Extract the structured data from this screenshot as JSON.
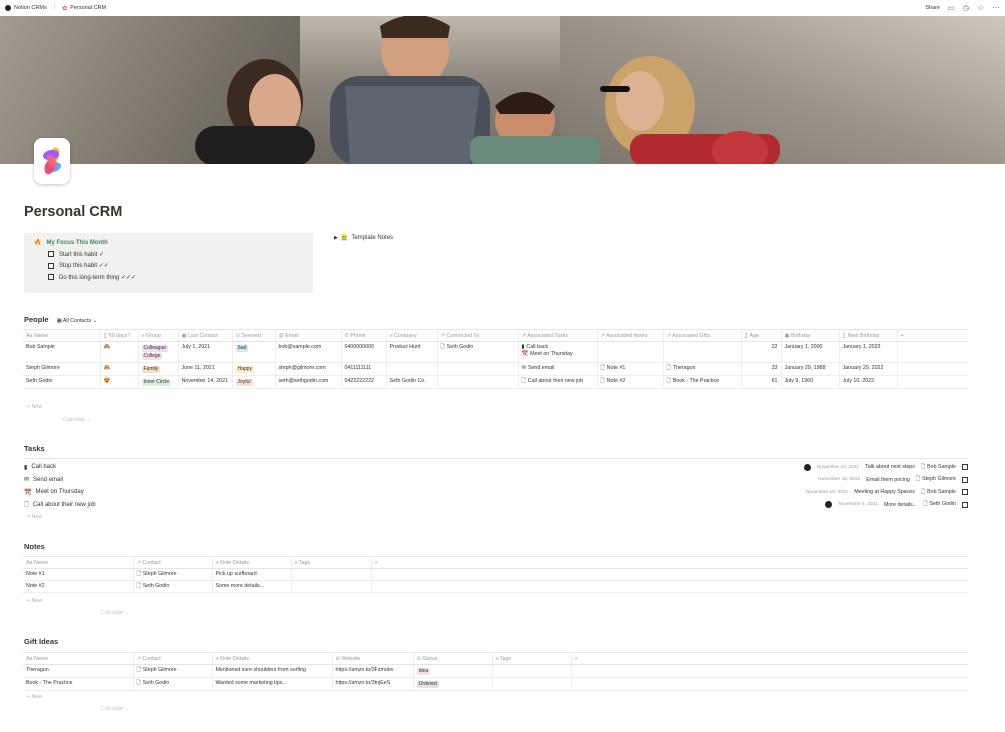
{
  "breadcrumb": {
    "parent": "Notion CRMs",
    "current": "Personal CRM"
  },
  "topbar": {
    "share": "Share"
  },
  "title": "Personal CRM",
  "focus": {
    "heading": "My Focus This Month",
    "items": [
      "Start this habit ✓",
      "Stop this habit ✓✓",
      "Do this long-term thing ✓✓✓"
    ]
  },
  "template_notes": "Template Notes",
  "people": {
    "title": "People",
    "view": "All Contacts",
    "columns": [
      "Name",
      "60 days?",
      "Group",
      "Last Contact",
      "Seemed",
      "Email",
      "Phone",
      "Company",
      "Connected To",
      "Associated Tasks",
      "Associated Notes",
      "Associated Gifts",
      "Age",
      "Birthday",
      "Next Birthday"
    ],
    "rows": [
      {
        "name": "Bob Sample",
        "d60": "🙈",
        "group": [
          "Colleague",
          "College"
        ],
        "last": "July 1, 2021",
        "seemed": "Sad",
        "email": "bob@sample.com",
        "phone": "0400000000",
        "company": "Product Hunt",
        "connected": "Seth Godin",
        "tasks": [
          "Call back",
          "Meet on Thursday"
        ],
        "notes": "",
        "gifts": "",
        "age": "22",
        "birthday": "January 1, 2000",
        "next": "January 1, 2023"
      },
      {
        "name": "Steph Gilmore",
        "d60": "🙈",
        "group": [
          "Family"
        ],
        "last": "June 11, 2021",
        "seemed": "Happy",
        "email": "steph@gilmore.com",
        "phone": "0411111111",
        "company": "",
        "connected": "",
        "tasks": [
          "Send email"
        ],
        "notes": "Note #1",
        "gifts": "Theragun",
        "age": "33",
        "birthday": "January 29, 1988",
        "next": "January 29, 2022"
      },
      {
        "name": "Seth Godin",
        "d60": "😍",
        "group": [
          "Inner Circle"
        ],
        "last": "November 14, 2021",
        "seemed": "Joyful",
        "email": "seth@sethgodin.com",
        "phone": "0422222222",
        "company": "Seth Godin Co.",
        "connected": "",
        "tasks": [
          "Call about their new job"
        ],
        "notes": "Note #2",
        "gifts": "Book - The Practice",
        "age": "61",
        "birthday": "July 9, 1960",
        "next": "July 10, 2022"
      }
    ],
    "new": "New",
    "calculate": "Calculate"
  },
  "tasks": {
    "title": "Tasks",
    "rows": [
      {
        "name": "Call back",
        "date": "November 23, 2021",
        "detail": "Talk about next steps",
        "person": "Bob Sample",
        "avatar": true
      },
      {
        "name": "Send email",
        "date": "November 18, 2021",
        "detail": "Email them pricing",
        "person": "Steph Gilmore",
        "avatar": false
      },
      {
        "name": "Meet on Thursday",
        "date": "November 19, 2021",
        "detail": "Meeting at Happy Spaces",
        "person": "Bob Sample",
        "avatar": false
      },
      {
        "name": "Call about their new job",
        "date": "November 5, 2021",
        "detail": "More details...",
        "person": "Seth Godin",
        "avatar": true
      }
    ],
    "new": "New"
  },
  "notes": {
    "title": "Notes",
    "columns": [
      "Name",
      "Contact",
      "Note Details",
      "Tags"
    ],
    "rows": [
      {
        "name": "Note #1",
        "contact": "Steph Gilmore",
        "details": "Pick up surfboard",
        "tags": ""
      },
      {
        "name": "Note #2",
        "contact": "Seth Godin",
        "details": "Some more details...",
        "tags": ""
      }
    ],
    "new": "New",
    "calculate": "Calculate"
  },
  "gifts": {
    "title": "Gift Ideas",
    "columns": [
      "Name",
      "Contact",
      "Note Details",
      "Website",
      "Status",
      "Tags"
    ],
    "rows": [
      {
        "name": "Theragun",
        "contact": "Steph Gilmore",
        "details": "Mentioned sore shoulders from surfing",
        "website": "https://amzn.to/3Fzmobv",
        "status": "Idea",
        "tags": ""
      },
      {
        "name": "Book - The Practice",
        "contact": "Seth Godin",
        "details": "Wanted some marketing tips...",
        "website": "https://amzn.to/3tnjEeS",
        "status": "Ordered",
        "tags": ""
      }
    ],
    "new": "New",
    "calculate": "Calculate"
  },
  "colors": {
    "tag_purple": "#e8deee",
    "tag_blue": "#d3e5ef",
    "tag_orange": "#fadec9",
    "tag_green": "#dbeddb",
    "tag_pink": "#f5e0e9",
    "tag_gray": "#e3e2e0",
    "tag_yellow": "#fdecc8",
    "focus_green": "#448361"
  }
}
